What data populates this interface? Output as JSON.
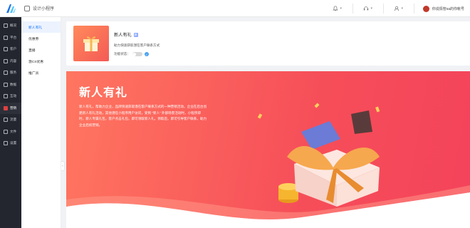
{
  "topbar": {
    "app_title": "设计小程序",
    "user_name": "你说情管sa的你帐号"
  },
  "sidebar": {
    "items": [
      {
        "label": "概况",
        "icon": "dashboard-icon"
      },
      {
        "label": "平台",
        "icon": "platform-icon"
      },
      {
        "label": "客户",
        "icon": "customer-icon"
      },
      {
        "label": "内容",
        "icon": "content-icon"
      },
      {
        "label": "服务",
        "icon": "service-icon"
      },
      {
        "label": "数据",
        "icon": "data-icon"
      },
      {
        "label": "互动",
        "icon": "interaction-icon"
      },
      {
        "label": "营销",
        "icon": "marketing-icon",
        "active": true
      },
      {
        "label": "流量",
        "icon": "traffic-icon"
      },
      {
        "label": "文件",
        "icon": "file-icon"
      },
      {
        "label": "设置",
        "icon": "settings-icon"
      }
    ]
  },
  "subnav": {
    "items": [
      {
        "label": "新人有礼",
        "active": true
      },
      {
        "label": "优惠券"
      },
      {
        "label": "直播"
      },
      {
        "label": "激CS优惠"
      },
      {
        "label": "推广员"
      }
    ]
  },
  "info_card": {
    "title": "新人有礼",
    "tag": "新",
    "description": "助力快速获取潜在客户联系方式",
    "status_label": "功能状态："
  },
  "banner": {
    "title": "新人有礼",
    "text": "新人有礼，帮助力企业，品牌快速获取潜在客户联系方式的一种营销活动，企业在后台创建新人有礼活动，其他潜在小程序用户访问，受到 “新人” 外部场景活动时，小程序即时，新人专属礼包，客户点击礼包，即可领取新人礼，领取后，即可引导客户联系，助力企业后续营销。"
  },
  "colors": {
    "accent": "#f4435b",
    "sidebar_bg": "#23262e",
    "active_blue": "#1677ff"
  }
}
